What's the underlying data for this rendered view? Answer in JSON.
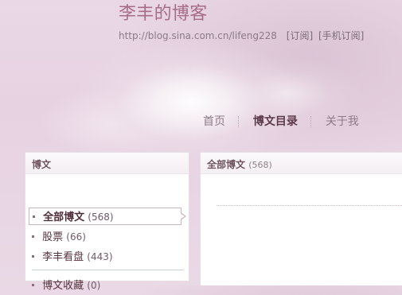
{
  "header": {
    "blog_title": "李丰的博客",
    "blog_url": "http://blog.sina.com.cn/lifeng228",
    "subscribe_label": "[订阅]",
    "mobile_subscribe_label": "[手机订阅]"
  },
  "nav": {
    "items": [
      {
        "label": "首页",
        "active": false
      },
      {
        "label": "博文目录",
        "active": true
      },
      {
        "label": "关于我",
        "active": false
      }
    ]
  },
  "sidebar": {
    "title": "博文",
    "items": [
      {
        "label": "全部博文",
        "count": "(568)",
        "active": true
      },
      {
        "label": "股票",
        "count": "(66)",
        "active": false
      },
      {
        "label": "李丰看盘",
        "count": "(443)",
        "active": false
      },
      {
        "label": "博文收藏",
        "count": "(0)",
        "active": false
      }
    ]
  },
  "main": {
    "title": "全部博文",
    "count": "(568)"
  },
  "colors": {
    "title": "#a66d8a",
    "active_nav": "#5a3a49",
    "panel_background": "#ffffff",
    "page_background": "#e7d2e2"
  },
  "icons": {
    "category_bullet": "square-bullet-icon",
    "active_pointer": "triangle-pointer-icon",
    "nav_separator": "dotted-separator-icon"
  }
}
